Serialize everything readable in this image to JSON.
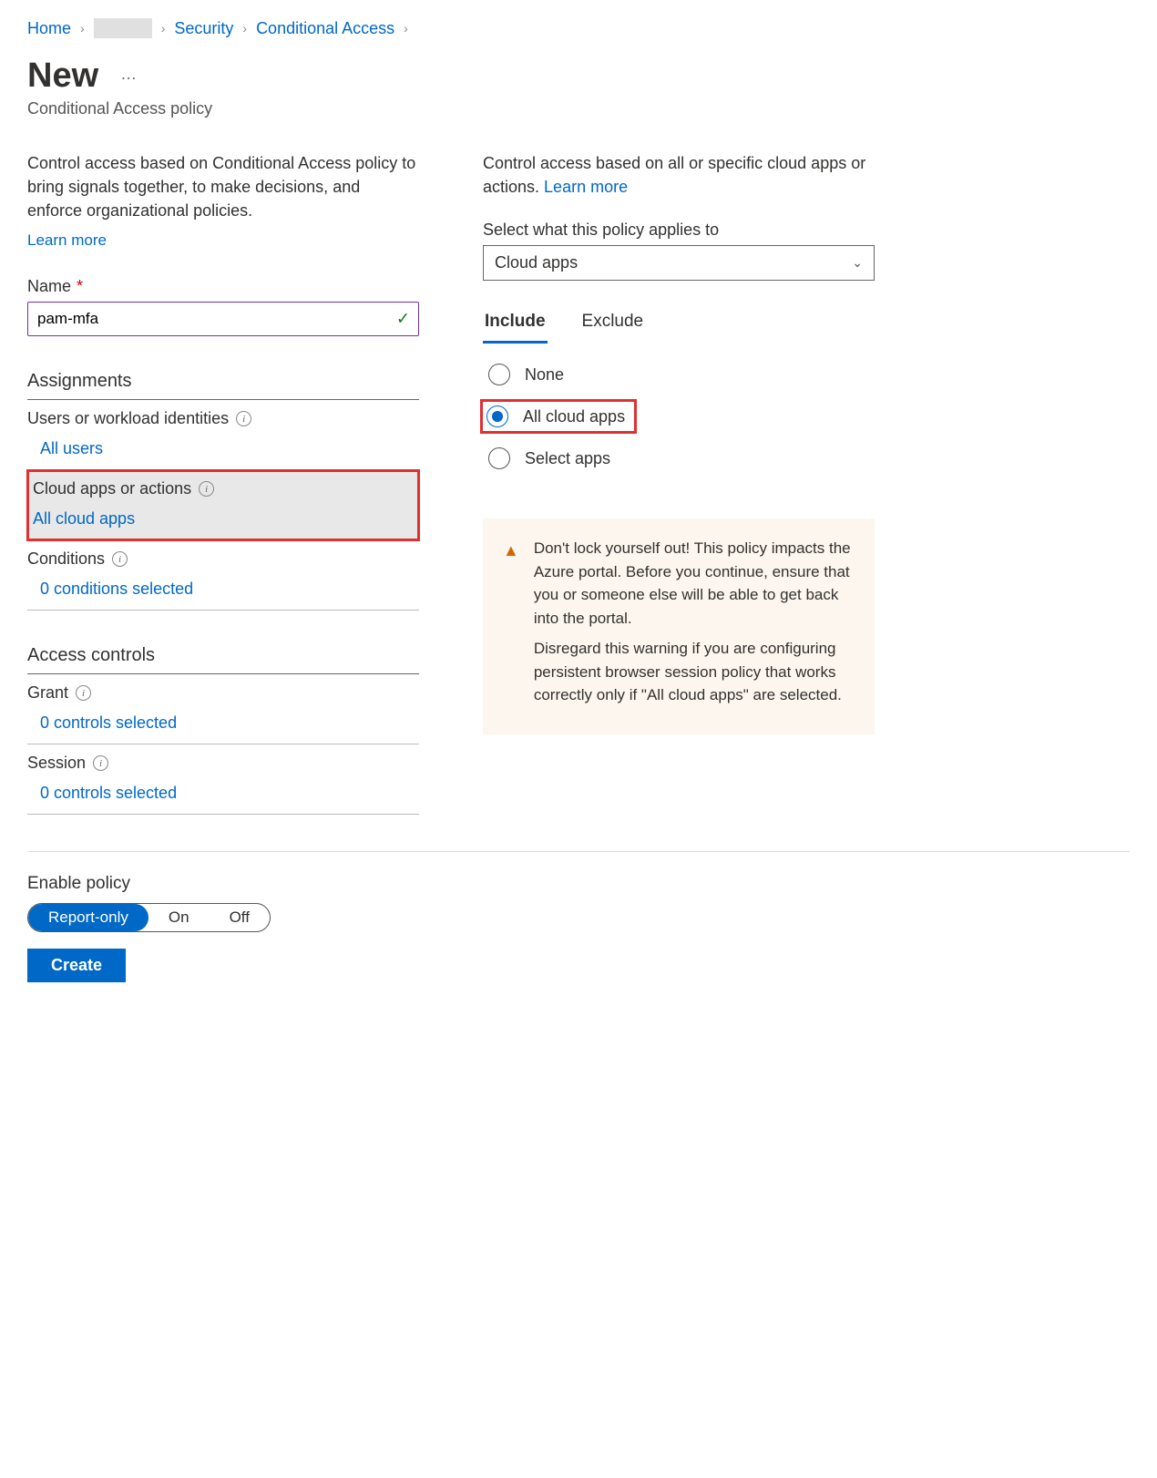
{
  "breadcrumb": {
    "home": "Home",
    "security": "Security",
    "conditional_access": "Conditional Access"
  },
  "page": {
    "title": "New",
    "more": "…",
    "subtitle": "Conditional Access policy"
  },
  "left": {
    "description": "Control access based on Conditional Access policy to bring signals together, to make decisions, and enforce organizational policies.",
    "learn_more": "Learn more",
    "name_label": "Name",
    "name_value": "pam-mfa",
    "assignments_header": "Assignments",
    "items": {
      "users": {
        "title": "Users or workload identities",
        "value": "All users"
      },
      "cloud": {
        "title": "Cloud apps or actions",
        "value": "All cloud apps"
      },
      "conditions": {
        "title": "Conditions",
        "value": "0 conditions selected"
      }
    },
    "access_controls_header": "Access controls",
    "grant": {
      "title": "Grant",
      "value": "0 controls selected"
    },
    "session": {
      "title": "Session",
      "value": "0 controls selected"
    }
  },
  "right": {
    "description": "Control access based on all or specific cloud apps or actions. ",
    "learn_more": "Learn more",
    "select_label": "Select what this policy applies to",
    "dropdown_value": "Cloud apps",
    "tabs": {
      "include": "Include",
      "exclude": "Exclude"
    },
    "radios": {
      "none": "None",
      "all": "All cloud apps",
      "select": "Select apps"
    },
    "warning": {
      "p1": "Don't lock yourself out! This policy impacts the Azure portal. Before you continue, ensure that you or someone else will be able to get back into the portal.",
      "p2": "Disregard this warning if you are configuring persistent browser session policy that works correctly only if \"All cloud apps\" are selected."
    }
  },
  "bottom": {
    "enable_label": "Enable policy",
    "toggle": {
      "report": "Report-only",
      "on": "On",
      "off": "Off"
    },
    "create": "Create"
  }
}
